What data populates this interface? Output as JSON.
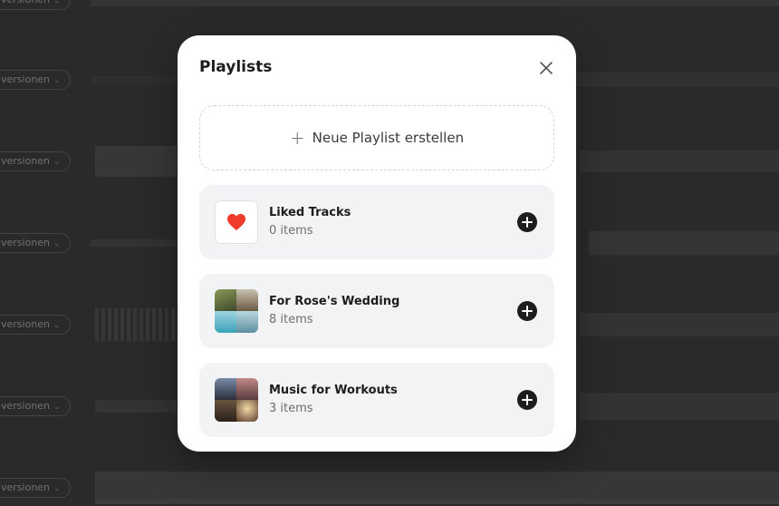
{
  "background": {
    "version_label": "versionen",
    "rows": 7
  },
  "modal": {
    "title": "Playlists",
    "close_icon": "close-icon",
    "create_label": "Neue Playlist erstellen",
    "create_icon": "plus-icon",
    "add_icon": "plus-circle-icon",
    "playlists": [
      {
        "name": "Liked Tracks",
        "count": "0 items",
        "thumb": "heart-icon"
      },
      {
        "name": "For Rose's Wedding",
        "count": "8 items",
        "thumb": "collage"
      },
      {
        "name": "Music for Workouts",
        "count": "3 items",
        "thumb": "collage"
      }
    ]
  },
  "colors": {
    "backdrop": "#2e2e2e",
    "modal_bg": "#ffffff",
    "item_bg": "#f2f3f5",
    "heart": "#ef3b2d",
    "add_button": "#1d1d1f"
  }
}
